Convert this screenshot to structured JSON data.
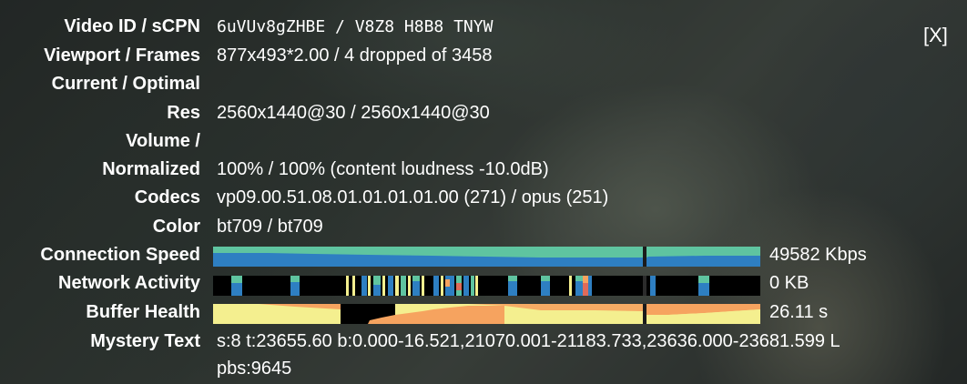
{
  "close_label": "[X]",
  "rows": {
    "video_id": {
      "label": "Video ID / sCPN",
      "value": "6uVUv8gZHBE / V8Z8 H8B8 TNYW"
    },
    "viewport": {
      "label": "Viewport / Frames",
      "value": "877x493*2.00 / 4 dropped of 3458"
    },
    "current_optimal": {
      "label": "Current / Optimal"
    },
    "res": {
      "label": "Res",
      "value": "2560x1440@30 / 2560x1440@30"
    },
    "volume": {
      "label": "Volume /"
    },
    "normalized": {
      "label": "Normalized",
      "value": "100% / 100% (content loudness -10.0dB)"
    },
    "codecs": {
      "label": "Codecs",
      "value": "vp09.00.51.08.01.01.01.01.00 (271) / opus (251)"
    },
    "color": {
      "label": "Color",
      "value": "bt709 / bt709"
    },
    "connection_speed": {
      "label": "Connection Speed",
      "value": "49582 Kbps"
    },
    "network_activity": {
      "label": "Network Activity",
      "value": "0 KB"
    },
    "buffer_health": {
      "label": "Buffer Health",
      "value": "26.11 s"
    },
    "mystery_text": {
      "label": "Mystery Text",
      "line1": "s:8 t:23655.60 b:0.000-16.521,21070.001-21183.733,23636.000-23681.599 L",
      "line2": "pbs:9645"
    }
  },
  "colors": {
    "speed_top": "#5fc4a0",
    "speed_bottom": "#2e7fc2",
    "network_bg": "#000000",
    "buffer_fill": "#f4ef8f",
    "buffer_level": "#f6a35f"
  }
}
